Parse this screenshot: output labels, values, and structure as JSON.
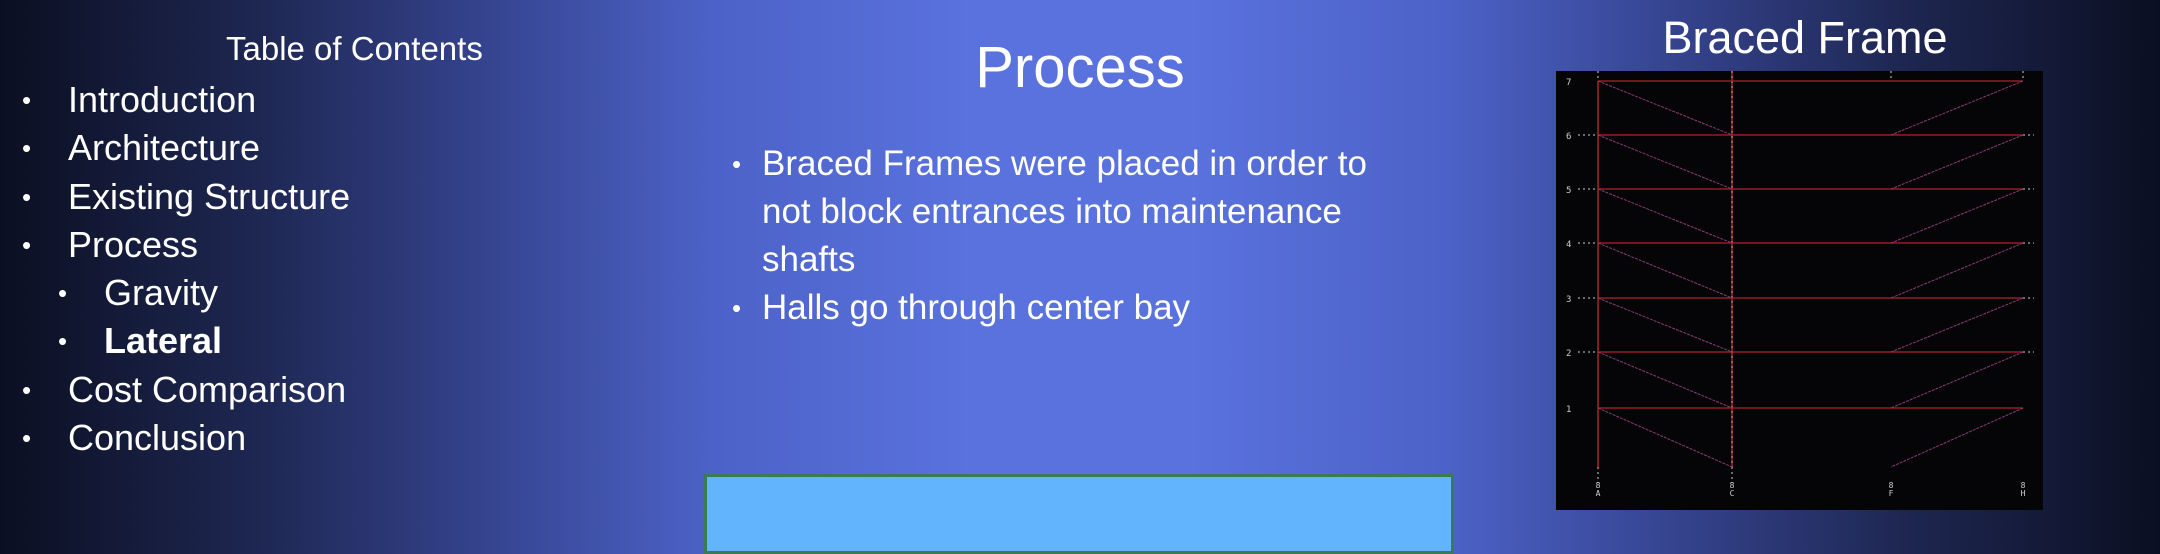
{
  "toc": {
    "title": "Table of Contents",
    "items": [
      {
        "label": "Introduction",
        "level": 1,
        "bold": false
      },
      {
        "label": "Architecture",
        "level": 1,
        "bold": false
      },
      {
        "label": "Existing Structure",
        "level": 1,
        "bold": false
      },
      {
        "label": "Process",
        "level": 1,
        "bold": false
      },
      {
        "label": "Gravity",
        "level": 2,
        "bold": false
      },
      {
        "label": "Lateral",
        "level": 2,
        "bold": true
      },
      {
        "label": "Cost Comparison",
        "level": 1,
        "bold": false
      },
      {
        "label": "Conclusion",
        "level": 1,
        "bold": false
      }
    ],
    "bullet": "•"
  },
  "main": {
    "title": "Process",
    "bullets": [
      "Braced Frames were placed in order to not block entrances into maintenance shafts",
      "Halls go through center bay"
    ]
  },
  "figure": {
    "title": "Braced Frame",
    "level_labels": [
      "7",
      "6",
      "5",
      "4",
      "3",
      "2",
      "1"
    ],
    "column_labels": [
      "8A",
      "8C",
      "8F",
      "8H"
    ],
    "colors": {
      "member": "#b0202a",
      "brace": "#8a3a78",
      "gridline": "#cfcfcf",
      "background": "#050507"
    }
  },
  "colors": {
    "content_box_fill": "#62b4fd",
    "content_box_border": "#3b7a54"
  }
}
